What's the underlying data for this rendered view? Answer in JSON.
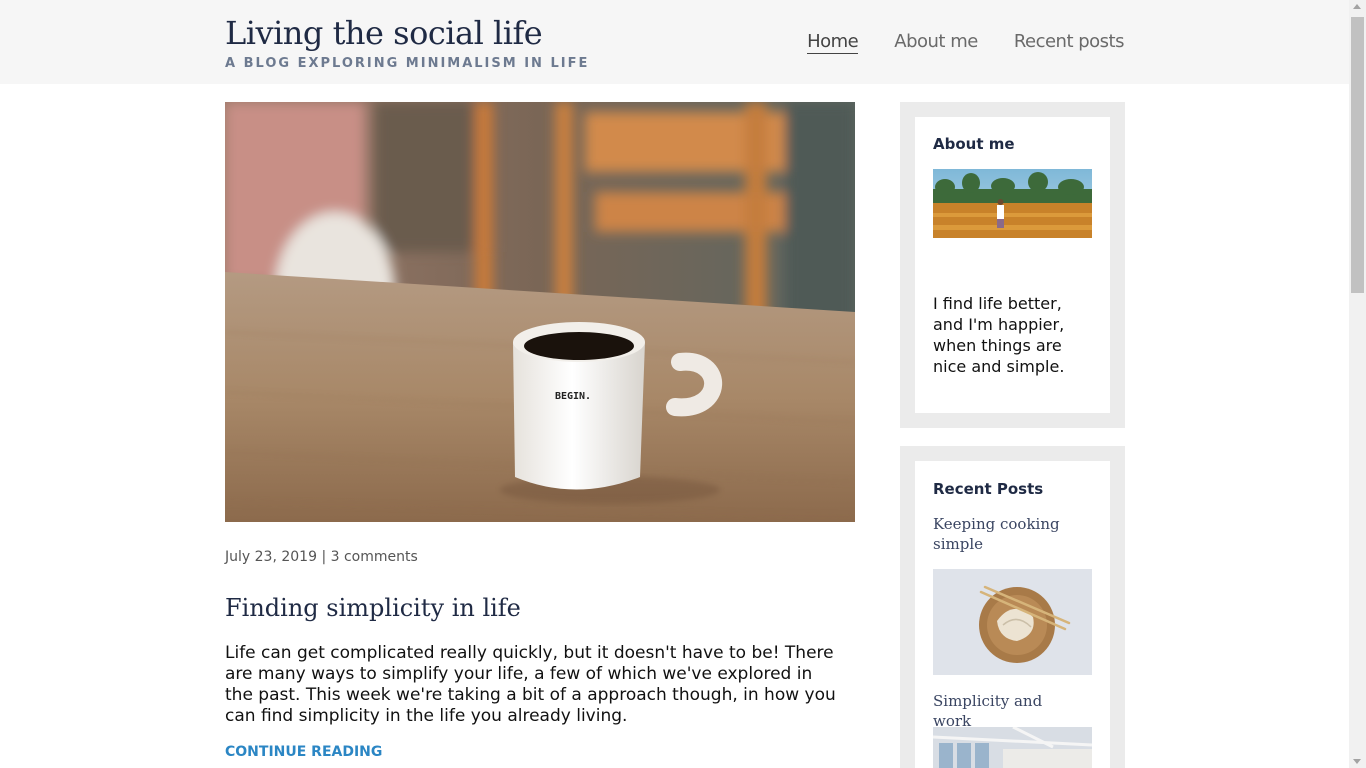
{
  "header": {
    "title": "Living the social life",
    "tagline": "A BLOG EXPLORING MINIMALISM IN LIFE",
    "nav": [
      {
        "label": "Home",
        "active": true
      },
      {
        "label": "About me",
        "active": false
      },
      {
        "label": "Recent posts",
        "active": false
      }
    ]
  },
  "post": {
    "image_label": "BEGIN.",
    "date": "July 23, 2019",
    "separator": "|",
    "comments": "3 comments",
    "title": "Finding simplicity in life",
    "excerpt": "Life can get complicated really quickly, but it doesn't have to be! There are many ways to simplify your life, a few of which we've explored in the past. This week we're taking a bit of a approach though, in how you can find simplicity in the life you already living.",
    "continue_label": "CONTINUE READING"
  },
  "sidebar": {
    "about": {
      "title": "About me",
      "text": "I find life better, and I'm happier, when things are nice and simple."
    },
    "recent": {
      "title": "Recent Posts",
      "items": [
        {
          "label": "Keeping cooking simple"
        },
        {
          "label": "Simplicity and work"
        }
      ]
    }
  },
  "colors": {
    "header_bg": "#f6f6f6",
    "title": "#1f2a44",
    "tagline": "#6d7a90",
    "link": "#2b86c4",
    "widget_bg": "#ebebeb"
  }
}
